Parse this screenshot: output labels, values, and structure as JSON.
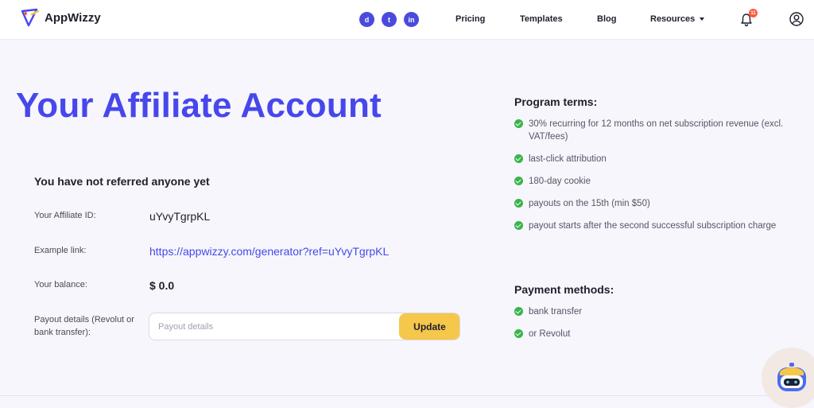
{
  "header": {
    "logo_text": "AppWizzy",
    "socials": [
      {
        "icon": "discord-icon",
        "glyph": "d"
      },
      {
        "icon": "twitter-icon",
        "glyph": "t"
      },
      {
        "icon": "linkedin-icon",
        "glyph": "in"
      }
    ],
    "nav": {
      "pricing": "Pricing",
      "templates": "Templates",
      "blog": "Blog",
      "resources": "Resources"
    },
    "notification_count": "11"
  },
  "main": {
    "title": "Your Affiliate Account",
    "referred_text": "You have not referred anyone yet",
    "affiliate_id_label": "Your Affiliate ID:",
    "affiliate_id_value": "uYvyTgrpKL",
    "example_link_label": "Example link:",
    "example_link_value": "https://appwizzy.com/generator?ref=uYvyTgrpKL",
    "balance_label": "Your balance:",
    "balance_value": "$ 0.0",
    "payout_label": "Payout details (Revolut or bank transfer):",
    "payout_placeholder": "Payout details",
    "payout_value": "",
    "update_button": "Update"
  },
  "program_terms": {
    "heading": "Program terms:",
    "items": [
      "30% recurring for 12 months on net subscription revenue (excl. VAT/fees)",
      "last-click attribution",
      "180-day cookie",
      "payouts on the 15th (min $50)",
      "payout starts after the second successful subscription charge"
    ]
  },
  "payment_methods": {
    "heading": "Payment methods:",
    "items": [
      "bank transfer",
      "or Revolut"
    ]
  },
  "colors": {
    "accent": "#4747ec",
    "check": "#39b54a",
    "button": "#f5c74a",
    "badge": "#ff5a3c"
  }
}
